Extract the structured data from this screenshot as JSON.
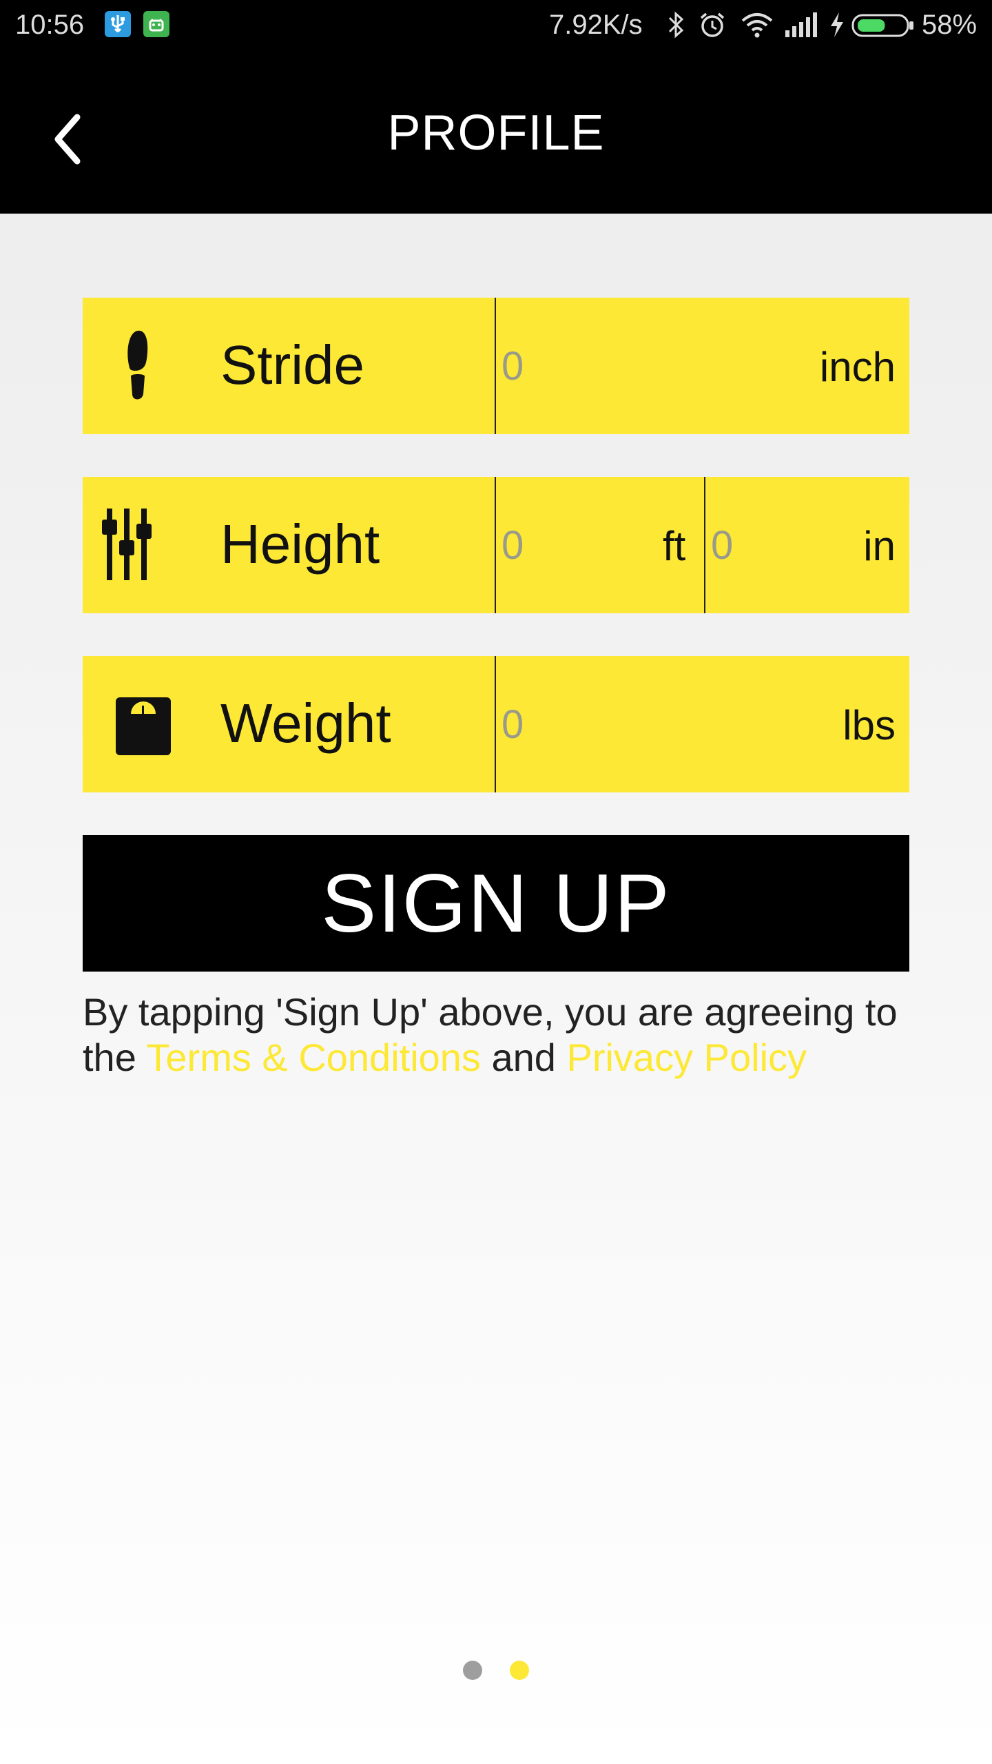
{
  "status_bar": {
    "time": "10:56",
    "speed": "7.92K/s",
    "battery_percent": "58%",
    "battery_level": 0.58,
    "battery_color": "#4cd964",
    "icons": [
      "usb-icon",
      "android-icon",
      "bluetooth-icon",
      "alarm-icon",
      "wifi-icon",
      "signal-icon",
      "charging-icon",
      "battery-icon"
    ]
  },
  "app_bar": {
    "title": "PROFILE",
    "back_icon": "chevron-left-icon"
  },
  "form": {
    "stride": {
      "label": "Stride",
      "value": "0",
      "unit": "inch",
      "icon": "footprint-icon"
    },
    "height": {
      "label": "Height",
      "feet_value": "0",
      "feet_unit": "ft",
      "inches_value": "0",
      "inches_unit": "in",
      "icon": "sliders-icon"
    },
    "weight": {
      "label": "Weight",
      "value": "0",
      "unit": "lbs",
      "icon": "scale-icon"
    }
  },
  "signup": {
    "button_label": "SIGN UP",
    "terms_prefix": "By tapping 'Sign Up' above, you are agreeing to the ",
    "terms_link": "Terms & Conditions",
    "terms_middle": " and ",
    "privacy_link": "Privacy Policy"
  },
  "pager": {
    "page_count": 2,
    "current_page": 2,
    "inactive_color": "#9e9e9e",
    "active_color": "#fce835"
  },
  "colors": {
    "accent_yellow": "#fce835",
    "bar_black": "#000000"
  }
}
